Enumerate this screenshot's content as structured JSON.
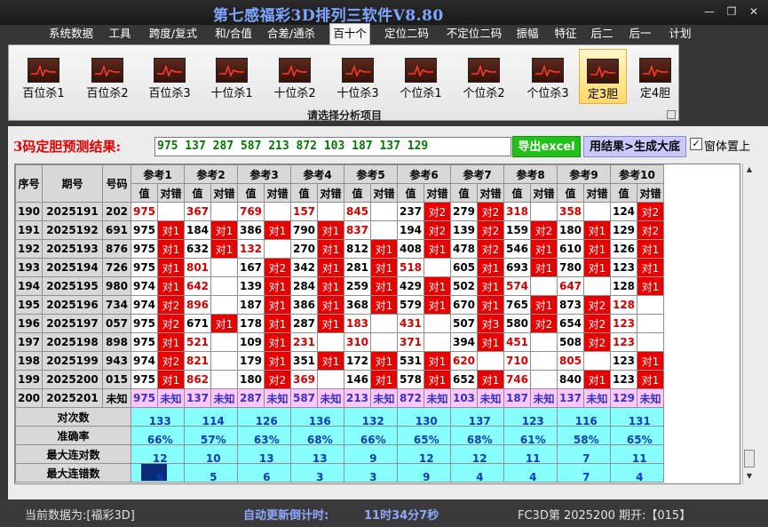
{
  "app": {
    "title": "第七感福彩3D排列三软件V8.80"
  },
  "window_buttons": {
    "minimize": "—",
    "maximize": "❐",
    "close": "✕"
  },
  "menu": [
    "系统数据",
    "工具",
    "跨度/复式",
    "和/合值",
    "合差/通杀",
    "百十个",
    "定位二码",
    "不定位二码",
    "振幅",
    "特征",
    "后二",
    "后一",
    "计划"
  ],
  "ribbon": {
    "buttons": [
      "百位杀1",
      "百位杀2",
      "百位杀3",
      "十位杀1",
      "十位杀2",
      "十位杀3",
      "个位杀1",
      "个位杀2",
      "个位杀3",
      "定3胆",
      "定4胆"
    ],
    "caption": "请选择分析项目"
  },
  "prediction": {
    "label": "3码定胆预测结果:",
    "value": "975 137 287 587 213 872 103 187 137 129",
    "export_button": "导出excel",
    "generate_button": "用结果>生成大底",
    "checkbox_mark": "✓",
    "checkbox_label": "窗体置上"
  },
  "table": {
    "col_headers": {
      "seq": "序号",
      "period": "期号",
      "number": "号码"
    },
    "refs": [
      "参考1",
      "参考2",
      "参考3",
      "参考4",
      "参考5",
      "参考6",
      "参考7",
      "参考8",
      "参考9",
      "参考10"
    ],
    "sub": {
      "val": "值",
      "chk": "对错"
    },
    "rows": [
      {
        "seq": "190",
        "period": "2025191",
        "num": "202",
        "c": [
          [
            "975",
            "",
            0
          ],
          [
            "367",
            "",
            0
          ],
          [
            "769",
            "",
            0
          ],
          [
            "157",
            "",
            0
          ],
          [
            "845",
            "",
            0
          ],
          [
            "237",
            "对2",
            1
          ],
          [
            "279",
            "对2",
            1
          ],
          [
            "318",
            "",
            0
          ],
          [
            "358",
            "",
            0
          ],
          [
            "124",
            "对2",
            1
          ]
        ]
      },
      {
        "seq": "191",
        "period": "2025192",
        "num": "691",
        "c": [
          [
            "975",
            "对1",
            1
          ],
          [
            "184",
            "对1",
            1
          ],
          [
            "386",
            "对1",
            1
          ],
          [
            "790",
            "对1",
            1
          ],
          [
            "837",
            "",
            0
          ],
          [
            "194",
            "对2",
            1
          ],
          [
            "139",
            "对2",
            1
          ],
          [
            "159",
            "对2",
            1
          ],
          [
            "180",
            "对1",
            1
          ],
          [
            "129",
            "对2",
            1
          ]
        ]
      },
      {
        "seq": "192",
        "period": "2025193",
        "num": "876",
        "c": [
          [
            "975",
            "对1",
            1
          ],
          [
            "632",
            "对1",
            1
          ],
          [
            "132",
            "",
            0
          ],
          [
            "270",
            "对1",
            1
          ],
          [
            "812",
            "对1",
            1
          ],
          [
            "408",
            "对1",
            1
          ],
          [
            "478",
            "对2",
            1
          ],
          [
            "546",
            "对1",
            1
          ],
          [
            "610",
            "对1",
            1
          ],
          [
            "126",
            "对1",
            1
          ]
        ]
      },
      {
        "seq": "193",
        "period": "2025194",
        "num": "726",
        "c": [
          [
            "975",
            "对1",
            1
          ],
          [
            "801",
            "",
            0
          ],
          [
            "167",
            "对2",
            1
          ],
          [
            "342",
            "对1",
            1
          ],
          [
            "281",
            "对1",
            1
          ],
          [
            "518",
            "",
            0
          ],
          [
            "605",
            "对1",
            1
          ],
          [
            "693",
            "对1",
            1
          ],
          [
            "780",
            "对1",
            1
          ],
          [
            "123",
            "对1",
            1
          ]
        ]
      },
      {
        "seq": "194",
        "period": "2025195",
        "num": "980",
        "c": [
          [
            "974",
            "对1",
            1
          ],
          [
            "642",
            "",
            0
          ],
          [
            "139",
            "对1",
            1
          ],
          [
            "284",
            "对1",
            1
          ],
          [
            "259",
            "对1",
            1
          ],
          [
            "429",
            "对1",
            1
          ],
          [
            "502",
            "对1",
            1
          ],
          [
            "574",
            "",
            0
          ],
          [
            "647",
            "",
            0
          ],
          [
            "128",
            "对1",
            1
          ]
        ]
      },
      {
        "seq": "195",
        "period": "2025196",
        "num": "734",
        "c": [
          [
            "974",
            "对2",
            1
          ],
          [
            "896",
            "",
            0
          ],
          [
            "187",
            "对1",
            1
          ],
          [
            "386",
            "对1",
            1
          ],
          [
            "368",
            "对1",
            1
          ],
          [
            "579",
            "对1",
            1
          ],
          [
            "670",
            "对1",
            1
          ],
          [
            "765",
            "对1",
            1
          ],
          [
            "873",
            "对2",
            1
          ],
          [
            "128",
            "",
            0
          ]
        ]
      },
      {
        "seq": "196",
        "period": "2025197",
        "num": "057",
        "c": [
          [
            "975",
            "对2",
            1
          ],
          [
            "671",
            "对1",
            1
          ],
          [
            "178",
            "对1",
            1
          ],
          [
            "287",
            "对1",
            1
          ],
          [
            "183",
            "",
            0
          ],
          [
            "431",
            "",
            0
          ],
          [
            "507",
            "对3",
            1
          ],
          [
            "580",
            "对2",
            1
          ],
          [
            "654",
            "对2",
            1
          ],
          [
            "123",
            "",
            0
          ]
        ]
      },
      {
        "seq": "197",
        "period": "2025198",
        "num": "898",
        "c": [
          [
            "975",
            "对1",
            1
          ],
          [
            "521",
            "",
            0
          ],
          [
            "109",
            "对1",
            1
          ],
          [
            "231",
            "",
            0
          ],
          [
            "310",
            "",
            0
          ],
          [
            "371",
            "",
            0
          ],
          [
            "394",
            "对1",
            1
          ],
          [
            "451",
            "",
            0
          ],
          [
            "508",
            "对2",
            1
          ],
          [
            "123",
            "",
            0
          ]
        ]
      },
      {
        "seq": "198",
        "period": "2025199",
        "num": "943",
        "c": [
          [
            "974",
            "对2",
            1
          ],
          [
            "821",
            "",
            0
          ],
          [
            "179",
            "对1",
            1
          ],
          [
            "351",
            "对1",
            1
          ],
          [
            "172",
            "对1",
            1
          ],
          [
            "531",
            "对1",
            1
          ],
          [
            "620",
            "",
            0
          ],
          [
            "710",
            "",
            0
          ],
          [
            "805",
            "",
            0
          ],
          [
            "123",
            "对1",
            1
          ]
        ]
      },
      {
        "seq": "199",
        "period": "2025200",
        "num": "015",
        "c": [
          [
            "975",
            "对1",
            1
          ],
          [
            "862",
            "",
            0
          ],
          [
            "180",
            "对2",
            1
          ],
          [
            "369",
            "",
            0
          ],
          [
            "146",
            "对1",
            1
          ],
          [
            "578",
            "对1",
            1
          ],
          [
            "652",
            "对1",
            1
          ],
          [
            "746",
            "",
            0
          ],
          [
            "840",
            "对1",
            1
          ],
          [
            "123",
            "对1",
            1
          ]
        ]
      }
    ],
    "next_row": {
      "seq": "200",
      "period": "2025201",
      "num": "未知",
      "vals": [
        "975",
        "137",
        "287",
        "587",
        "213",
        "872",
        "103",
        "187",
        "137",
        "129"
      ],
      "unknown": "未知"
    },
    "stats": [
      {
        "label": "对次数",
        "vals": [
          "133",
          "114",
          "126",
          "136",
          "132",
          "130",
          "137",
          "123",
          "116",
          "131"
        ]
      },
      {
        "label": "准确率",
        "vals": [
          "66%",
          "57%",
          "63%",
          "68%",
          "66%",
          "65%",
          "68%",
          "61%",
          "58%",
          "65%"
        ]
      },
      {
        "label": "最大连对数",
        "vals": [
          "12",
          "10",
          "13",
          "13",
          "9",
          "12",
          "12",
          "11",
          "7",
          "11"
        ]
      },
      {
        "label": "最大连错数",
        "vals": [
          "6",
          "5",
          "6",
          "3",
          "3",
          "9",
          "4",
          "4",
          "7",
          "4"
        ]
      }
    ]
  },
  "statusbar": {
    "current_data": "当前数据为:[福彩3D]",
    "countdown_label": "自动更新倒计时:",
    "countdown_value": "11时34分7秒",
    "period_info": "FC3D第 2025200 期开:【015】"
  },
  "colors": {
    "hit": "#e80000",
    "unknown": "#ffc6ff",
    "stat": "#88ffff",
    "accent_title": "#7ea6ff"
  }
}
